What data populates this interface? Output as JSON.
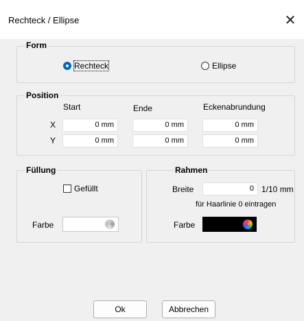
{
  "window": {
    "title": "Rechteck / Ellipse"
  },
  "form": {
    "title": "Form",
    "options": [
      {
        "label": "Rechteck",
        "checked": true
      },
      {
        "label": "Ellipse",
        "checked": false
      }
    ]
  },
  "position": {
    "title": "Position",
    "columns": {
      "start": "Start",
      "end": "Ende",
      "corner": "Eckenabrundung"
    },
    "rows": [
      {
        "label": "X",
        "start": "0 mm",
        "end": "0 mm",
        "corner": "0 mm"
      },
      {
        "label": "Y",
        "start": "0 mm",
        "end": "0 mm",
        "corner": "0 mm"
      }
    ]
  },
  "fill": {
    "title": "Füllung",
    "checkbox_label": "Gefüllt",
    "checked": false,
    "color_label": "Farbe",
    "color_value": "#ffffff"
  },
  "border": {
    "title": "Rahmen",
    "width_label": "Breite",
    "width_value": "0",
    "width_unit": "1/10 mm",
    "hint": "für Haarlinie 0 eintragen",
    "color_label": "Farbe",
    "color_value": "#000000"
  },
  "buttons": {
    "ok": "Ok",
    "cancel": "Abbrechen"
  },
  "icons": {
    "close": "close-icon",
    "palette": "color-palette-icon"
  }
}
